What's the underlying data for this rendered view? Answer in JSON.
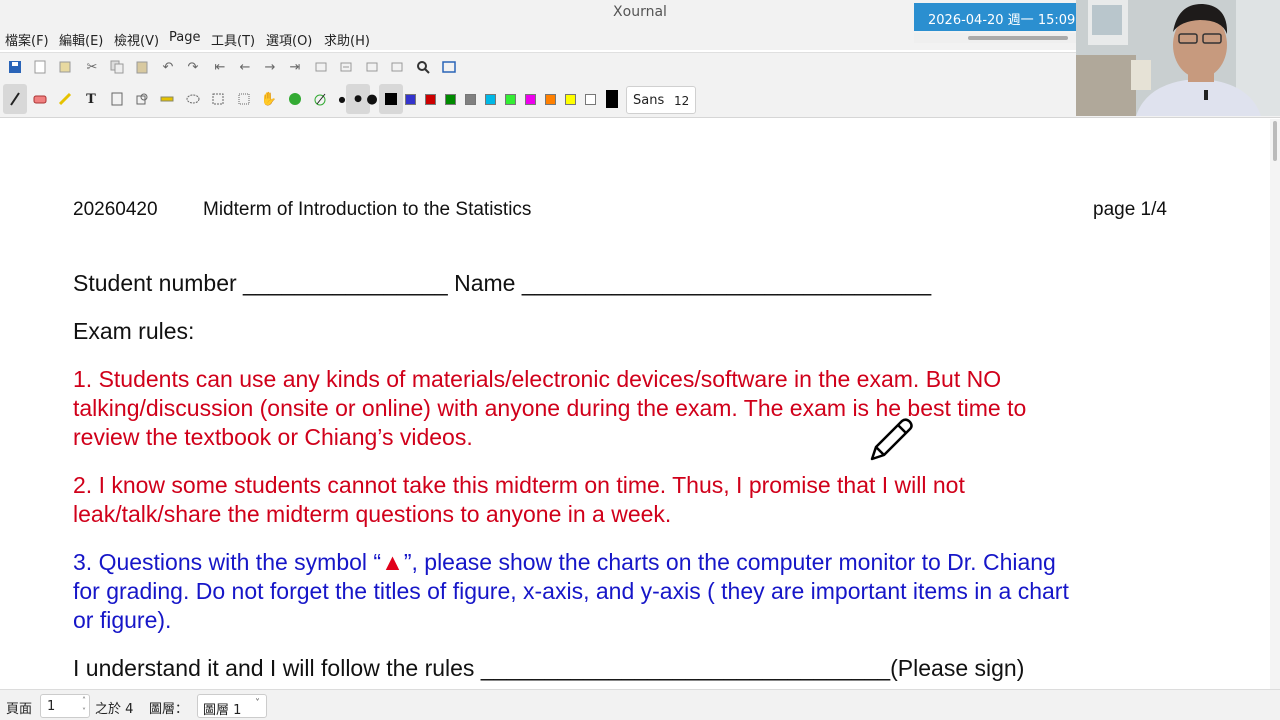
{
  "window": {
    "title": "Xournal"
  },
  "menu": [
    "檔案(F)",
    "編輯(E)",
    "檢視(V)",
    "Page",
    "工具(T)",
    "選項(O)",
    "求助(H)"
  ],
  "overlay": {
    "date_text": "2026-04-20 週一 15:09:"
  },
  "toolbar": {
    "font_name": "Sans",
    "font_size": "12",
    "colors": [
      "#000000",
      "#3333cc",
      "#cc0000",
      "#008a00",
      "#808080",
      "#00b8e6",
      "#33ee33",
      "#ee00ee",
      "#ff8000",
      "#ffff00",
      "#ffffff"
    ]
  },
  "document": {
    "header_date": "20260420",
    "header_title": "Midterm of Introduction to the Statistics",
    "header_page": "page 1/4",
    "student_line": "Student number ________________   Name ________________________________",
    "rules_heading": "Exam rules:",
    "rule1_l1": "1. Students can use any kinds of materials/electronic devices/software in the exam. But NO",
    "rule1_l2": "talking/discussion (onsite or online) with anyone during the exam. The exam is he best time to",
    "rule1_l3": "review the textbook or Chiang’s videos.",
    "rule2_l1": "2. I know some students cannot take this midterm on time. Thus, I promise that I will not",
    "rule2_l2": "leak/talk/share the midterm questions to anyone in a week.",
    "rule3_l1a": "3. Questions with the symbol “",
    "rule3_symbol": "▲",
    "rule3_l1b": "”, please show the charts on the computer monitor to Dr. Chiang",
    "rule3_l2": "for grading. Do not forget the titles of figure, x-axis, and y-axis ( they are important items in a chart",
    "rule3_l3": "or figure).",
    "sign_line": "I understand it and I will follow the rules ________________________________(Please sign)"
  },
  "status": {
    "page_label": "頁面",
    "page_value": "1",
    "of_label": "之於 4",
    "layer_label": "圖層：",
    "layer_value": "圖層 1"
  }
}
